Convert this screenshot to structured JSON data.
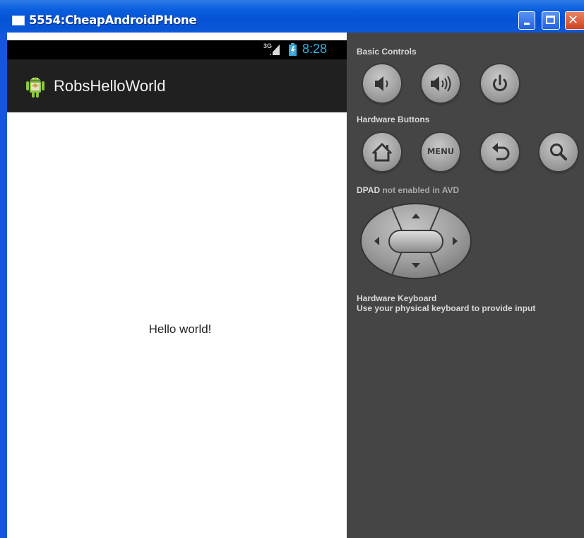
{
  "window": {
    "title": "5554:CheapAndroidPHone",
    "buttons": {
      "minimize": "minimize",
      "maximize": "maximize",
      "close": "✕"
    }
  },
  "phone": {
    "status": {
      "network": "3G",
      "clock": "8:28",
      "clock_color": "#2fb3e6"
    },
    "app_title": "RobsHelloWorld",
    "content_text": "Hello world!"
  },
  "controls": {
    "basic_label": "Basic Controls",
    "basic_buttons": [
      {
        "icon": "volume-down-icon"
      },
      {
        "icon": "volume-up-icon"
      },
      {
        "icon": "power-icon"
      }
    ],
    "hardware_label": "Hardware Buttons",
    "hardware_buttons": [
      {
        "icon": "home-icon"
      },
      {
        "label": "MENU"
      },
      {
        "icon": "back-icon"
      },
      {
        "icon": "search-icon"
      }
    ],
    "dpad_label_prefix": "DPAD",
    "dpad_label_suffix": "not enabled in AVD",
    "keyboard_title": "Hardware Keyboard",
    "keyboard_hint": "Use your physical keyboard to provide input"
  }
}
